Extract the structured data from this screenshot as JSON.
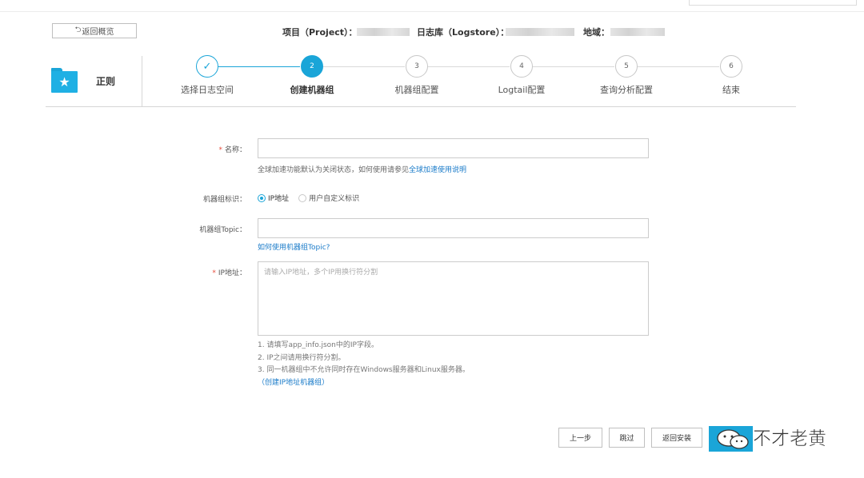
{
  "header": {
    "back_label": "返回概览",
    "project_label": "项目（Project）：",
    "logstore_label": "日志库（Logstore）：",
    "region_label": "地域："
  },
  "sidebar_card": {
    "title": "正则",
    "icon": "folder-star-icon"
  },
  "steps": [
    {
      "num": "✓",
      "label": "选择日志空间",
      "state": "done"
    },
    {
      "num": "2",
      "label": "创建机器组",
      "state": "active"
    },
    {
      "num": "3",
      "label": "机器组配置",
      "state": "pending"
    },
    {
      "num": "4",
      "label": "Logtail配置",
      "state": "pending"
    },
    {
      "num": "5",
      "label": "查询分析配置",
      "state": "pending"
    },
    {
      "num": "6",
      "label": "结束",
      "state": "pending"
    }
  ],
  "form": {
    "name": {
      "required_mark": "*",
      "label": "名称：",
      "value": "",
      "hint_prefix": "全球加速功能默认为关闭状态，如何使用请参见",
      "hint_link": "全球加速使用说明"
    },
    "identifier": {
      "label": "机器组标识：",
      "options": [
        "IP地址",
        "用户自定义标识"
      ],
      "selected": "IP地址"
    },
    "topic": {
      "label": "机器组Topic：",
      "value": "",
      "help_link": "如何使用机器组Topic?"
    },
    "ip": {
      "required_mark": "*",
      "label": "IP地址：",
      "placeholder": "请输入IP地址，多个IP用换行符分割",
      "notes": [
        "1. 请填写app_info.json中的IP字段。",
        "2. IP之间请用换行符分割。",
        "3. 同一机器组中不允许同时存在Windows服务器和Linux服务器。"
      ],
      "create_link": "（创建IP地址机器组）"
    }
  },
  "footer": {
    "prev_label": "上一步",
    "skip_label": "跳过",
    "back_install_label": "返回安装"
  },
  "watermark": {
    "text": "不才老黄"
  },
  "colors": {
    "accent": "#1aa5d8",
    "link": "#1a7bc9",
    "required": "#e74c3c"
  }
}
